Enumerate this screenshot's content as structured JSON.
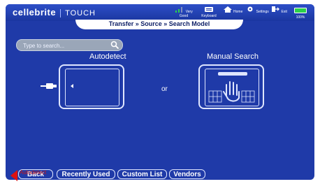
{
  "app": {
    "brand": "cellebrite",
    "product": "TOUCH"
  },
  "status_icons": [
    {
      "name": "signal-icon",
      "label": "Very Good"
    },
    {
      "name": "keyboard-icon",
      "label": "Keyboard"
    },
    {
      "name": "home-icon",
      "label": "Home"
    },
    {
      "name": "settings-icon",
      "label": "Settings"
    },
    {
      "name": "exit-icon",
      "label": "Exit"
    },
    {
      "name": "battery-icon",
      "label": "100%"
    }
  ],
  "breadcrumb": "Transfer » Source » Search Model",
  "search": {
    "placeholder": "Type to search..."
  },
  "options": {
    "autodetect_label": "Autodetect",
    "or_label": "or",
    "manual_label": "Manual Search"
  },
  "tooltip": "Autodetect",
  "bottom_buttons": {
    "back": "Back",
    "recently_used": "Recently Used",
    "custom_list": "Custom List",
    "vendors": "Vendors"
  },
  "colors": {
    "background": "#1f3aa8",
    "accent": "#ffffff",
    "battery": "#2bd14a",
    "tooltip": "#cc1616"
  }
}
